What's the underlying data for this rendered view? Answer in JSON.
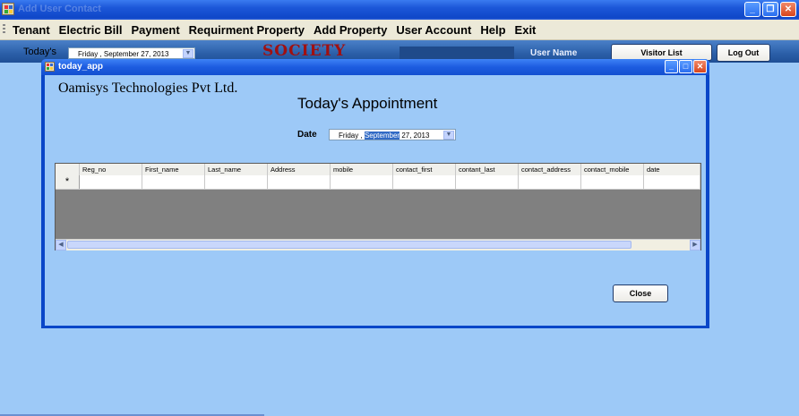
{
  "window": {
    "title": "Add User Contact"
  },
  "menu": [
    "Tenant",
    "Electric Bill",
    "Payment",
    "Requirment Property",
    "Add Property",
    "User Account",
    "Help",
    "Exit"
  ],
  "toolbar": {
    "todays_label": "Today's",
    "date_day": "Friday",
    "date_rest": ", September 27, 2013",
    "society": "SOCIETY",
    "user_name": "User Name",
    "visitor_list": "Visitor List",
    "logout": "Log Out"
  },
  "child": {
    "title": "today_app",
    "company": "Oamisys Technologies Pvt Ltd.",
    "heading": "Today's Appointment",
    "date_label": "Date",
    "date_day": "Friday",
    "date_month": "September",
    "date_rest": "27, 2013",
    "close_button": "Close"
  },
  "grid": {
    "columns": [
      "Reg_no",
      "First_name",
      "Last_name",
      "Address",
      "mobile",
      "contact_first",
      "contant_last",
      "contact_address",
      "contact_mobile",
      "date"
    ],
    "new_row_marker": "*"
  }
}
